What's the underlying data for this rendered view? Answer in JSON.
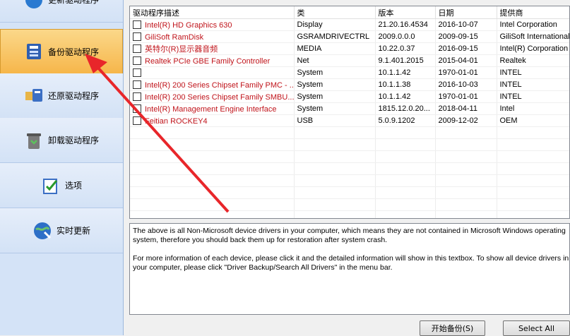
{
  "sidebar": {
    "items": [
      {
        "label": "更新驱动程序",
        "icon": "refresh-driver-icon"
      },
      {
        "label": "备份驱动程序",
        "icon": "backup-driver-icon"
      },
      {
        "label": "还原驱动程序",
        "icon": "restore-driver-icon"
      },
      {
        "label": "卸载驱动程序",
        "icon": "uninstall-driver-icon"
      },
      {
        "label": "选项",
        "icon": "options-icon"
      },
      {
        "label": "实时更新",
        "icon": "live-update-icon"
      }
    ]
  },
  "table": {
    "headers": [
      "驱动程序描述",
      "类",
      "版本",
      "日期",
      "提供商"
    ],
    "rows": [
      [
        "Intel(R) HD Graphics 630",
        "Display",
        "21.20.16.4534",
        "2016-10-07",
        "Intel Corporation"
      ],
      [
        "GiliSoft RamDisk",
        "GSRAMDRIVECTRL",
        "2009.0.0.0",
        "2009-09-15",
        "GiliSoft International"
      ],
      [
        "英特尔(R)显示器音频",
        "MEDIA",
        "10.22.0.37",
        "2016-09-15",
        "Intel(R) Corporation"
      ],
      [
        "Realtek PCIe GBE Family Controller",
        "Net",
        "9.1.401.2015",
        "2015-04-01",
        "Realtek"
      ],
      [
        "",
        "System",
        "10.1.1.42",
        "1970-01-01",
        "INTEL"
      ],
      [
        "Intel(R) 200 Series Chipset Family PMC - ...",
        "System",
        "10.1.1.38",
        "2016-10-03",
        "INTEL"
      ],
      [
        "Intel(R) 200 Series Chipset Family SMBU...",
        "System",
        "10.1.1.42",
        "1970-01-01",
        "INTEL"
      ],
      [
        "Intel(R) Management Engine Interface",
        "System",
        "1815.12.0.20...",
        "2018-04-11",
        "Intel"
      ],
      [
        "Feitian ROCKEY4",
        "USB",
        "5.0.9.1202",
        "2009-12-02",
        "OEM"
      ]
    ]
  },
  "description": {
    "line1": "The above is all Non-Microsoft device drivers in your computer, which means they are not contained in Microsoft Windows operating",
    "line2": "system, therefore you should back them up for restoration after system crash.",
    "line3": "For more information of each device, please click it and the detailed information will show in this textbox. To show all device drivers in",
    "line4": "your computer, please click \"Driver Backup/Search All Drivers\" in the menu bar."
  },
  "buttons": {
    "start_backup": "开始备份(S)",
    "select_all": "Select All"
  },
  "colors": {
    "sidebar_bg": "#d4e3f7",
    "active_item": "#f6b64a",
    "driver_name": "#c0141b",
    "arrow": "#e8262a"
  }
}
